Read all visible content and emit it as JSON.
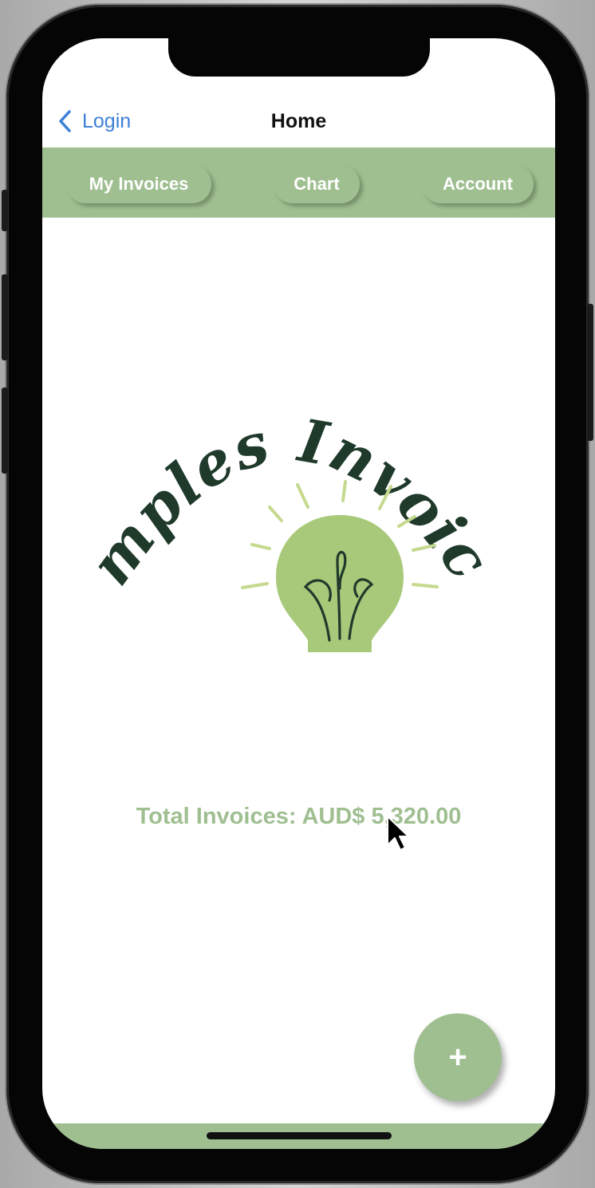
{
  "navbar": {
    "back_label": "Login",
    "title": "Home"
  },
  "tabs": [
    {
      "label": "My Invoices"
    },
    {
      "label": "Chart"
    },
    {
      "label": "Account"
    }
  ],
  "logo": {
    "title_text": "Simples Invoices",
    "icon": "lightbulb-icon"
  },
  "summary": {
    "total_text": "Total Invoices: AUD$ 5,320.00"
  },
  "fab": {
    "label": "+",
    "icon": "plus-icon"
  },
  "colors": {
    "accent_green": "#9fbf91",
    "link_blue": "#3b7fd6",
    "logo_dark": "#1f3a2b",
    "bulb_green": "#a9c97a"
  }
}
